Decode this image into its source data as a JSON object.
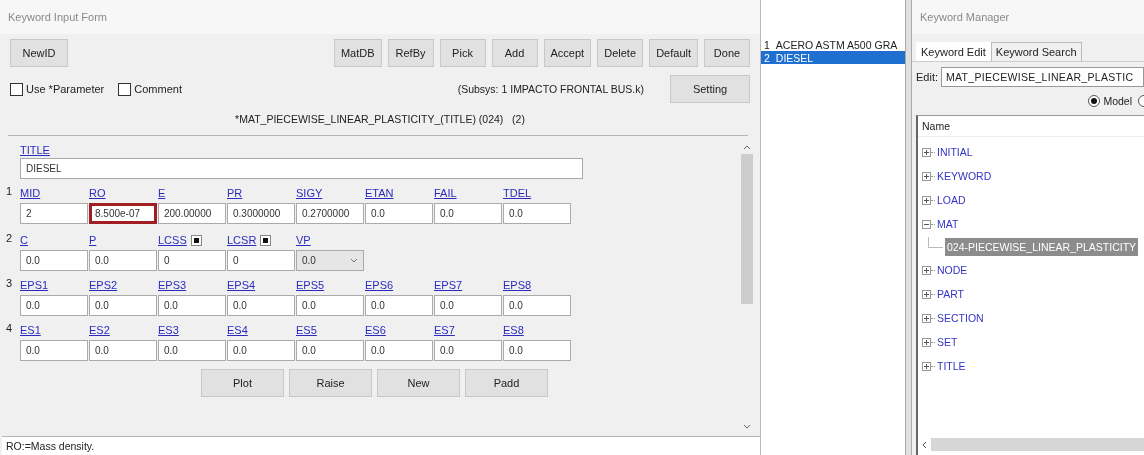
{
  "form": {
    "title": "Keyword Input Form",
    "left_buttons": [
      "NewID"
    ],
    "right_buttons": [
      "MatDB",
      "RefBy",
      "Pick",
      "Add",
      "Accept",
      "Delete",
      "Default",
      "Done"
    ],
    "options": [
      {
        "label": "Use *Parameter",
        "checked": false
      },
      {
        "label": "Comment",
        "checked": false
      }
    ],
    "subsys": "(Subsys: 1 IMPACTO FRONTAL BUS.k)",
    "setting_button": "Setting",
    "keyword_title": "*MAT_PIECEWISE_LINEAR_PLASTICITY_(TITLE) (024)   (2)",
    "title_field": {
      "label": "TITLE",
      "value": "DIESEL"
    },
    "cards": [
      {
        "number": "1",
        "fields": [
          {
            "label": "MID",
            "value": "2",
            "kind": "text",
            "highlighted": false
          },
          {
            "label": "RO",
            "value": "8.500e-07",
            "kind": "text",
            "highlighted": true
          },
          {
            "label": "E",
            "value": "200.00000",
            "kind": "text",
            "highlighted": false
          },
          {
            "label": "PR",
            "value": "0.3000000",
            "kind": "text",
            "highlighted": false
          },
          {
            "label": "SIGY",
            "value": "0.2700000",
            "kind": "text",
            "highlighted": false
          },
          {
            "label": "ETAN",
            "value": "0.0",
            "kind": "text",
            "highlighted": false
          },
          {
            "label": "FAIL",
            "value": "0.0",
            "kind": "text",
            "highlighted": false
          },
          {
            "label": "TDEL",
            "value": "0.0",
            "kind": "text",
            "highlighted": false
          }
        ]
      },
      {
        "number": "2",
        "fields": [
          {
            "label": "C",
            "value": "0.0",
            "kind": "text",
            "highlighted": false
          },
          {
            "label": "P",
            "value": "0.0",
            "kind": "text",
            "highlighted": false
          },
          {
            "label": "LCSS",
            "value": "0",
            "kind": "pick",
            "highlighted": false
          },
          {
            "label": "LCSR",
            "value": "0",
            "kind": "pick",
            "highlighted": false
          },
          {
            "label": "VP",
            "value": "0.0",
            "kind": "select",
            "highlighted": false
          }
        ]
      },
      {
        "number": "3",
        "fields": [
          {
            "label": "EPS1",
            "value": "0.0",
            "kind": "text",
            "highlighted": false
          },
          {
            "label": "EPS2",
            "value": "0.0",
            "kind": "text",
            "highlighted": false
          },
          {
            "label": "EPS3",
            "value": "0.0",
            "kind": "text",
            "highlighted": false
          },
          {
            "label": "EPS4",
            "value": "0.0",
            "kind": "text",
            "highlighted": false
          },
          {
            "label": "EPS5",
            "value": "0.0",
            "kind": "text",
            "highlighted": false
          },
          {
            "label": "EPS6",
            "value": "0.0",
            "kind": "text",
            "highlighted": false
          },
          {
            "label": "EPS7",
            "value": "0.0",
            "kind": "text",
            "highlighted": false
          },
          {
            "label": "EPS8",
            "value": "0.0",
            "kind": "text",
            "highlighted": false
          }
        ]
      },
      {
        "number": "4",
        "fields": [
          {
            "label": "ES1",
            "value": "0.0",
            "kind": "text",
            "highlighted": false
          },
          {
            "label": "ES2",
            "value": "0.0",
            "kind": "text",
            "highlighted": false
          },
          {
            "label": "ES3",
            "value": "0.0",
            "kind": "text",
            "highlighted": false
          },
          {
            "label": "ES4",
            "value": "0.0",
            "kind": "text",
            "highlighted": false
          },
          {
            "label": "ES5",
            "value": "0.0",
            "kind": "text",
            "highlighted": false
          },
          {
            "label": "ES6",
            "value": "0.0",
            "kind": "text",
            "highlighted": false
          },
          {
            "label": "ES7",
            "value": "0.0",
            "kind": "text",
            "highlighted": false
          },
          {
            "label": "ES8",
            "value": "0.0",
            "kind": "text",
            "highlighted": false
          }
        ]
      }
    ],
    "bottom_buttons": [
      "Plot",
      "Raise",
      "New",
      "Padd"
    ],
    "status": "RO:=Mass density."
  },
  "material_list": [
    {
      "number": "1",
      "name": "ACERO ASTM A500 GRA",
      "selected": false
    },
    {
      "number": "2",
      "name": "DIESEL",
      "selected": true
    }
  ],
  "keyword_manager": {
    "title": "Keyword Manager",
    "tabs": [
      {
        "label": "Keyword Edit",
        "selected": true
      },
      {
        "label": "Keyword Search",
        "selected": false
      }
    ],
    "edit_label": "Edit:",
    "edit_value": "MAT_PIECEWISE_LINEAR_PLASTIC",
    "radios": [
      {
        "label": "Model",
        "selected": true
      },
      {
        "selected": false
      }
    ],
    "tree": {
      "header": "Name",
      "items": [
        {
          "label": "INITIAL",
          "expanded": false,
          "selected": false
        },
        {
          "label": "KEYWORD",
          "expanded": false,
          "selected": false
        },
        {
          "label": "LOAD",
          "expanded": false,
          "selected": false
        },
        {
          "label": "MAT",
          "expanded": true,
          "selected": false,
          "children": [
            {
              "label": "024-PIECEWISE_LINEAR_PLASTICITY",
              "selected": true
            }
          ]
        },
        {
          "label": "NODE",
          "expanded": false,
          "selected": false
        },
        {
          "label": "PART",
          "expanded": false,
          "selected": false
        },
        {
          "label": "SECTION",
          "expanded": false,
          "selected": false
        },
        {
          "label": "SET",
          "expanded": false,
          "selected": false
        },
        {
          "label": "TITLE",
          "expanded": false,
          "selected": false
        }
      ]
    }
  }
}
